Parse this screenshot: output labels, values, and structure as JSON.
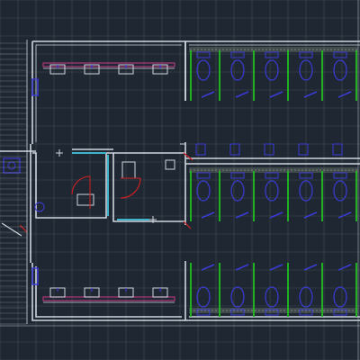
{
  "drawing": {
    "kind": "restroom floor plan (CAD, dark model space)",
    "colors": {
      "background": "#1f2733",
      "grid": "#5d6f63",
      "wall": "#cfd6de",
      "fixture": "#3b3bd6",
      "partition": "#1fbf1f",
      "hatch": "#7d8a7a",
      "counter": "#b0367a",
      "door": "#d12020",
      "accent": "#3fb3c9"
    },
    "upper_stall_count": 5,
    "mid_stall_count": 5,
    "lower_stall_count": 5,
    "upper_sinks": 4,
    "lower_sinks": 4
  }
}
